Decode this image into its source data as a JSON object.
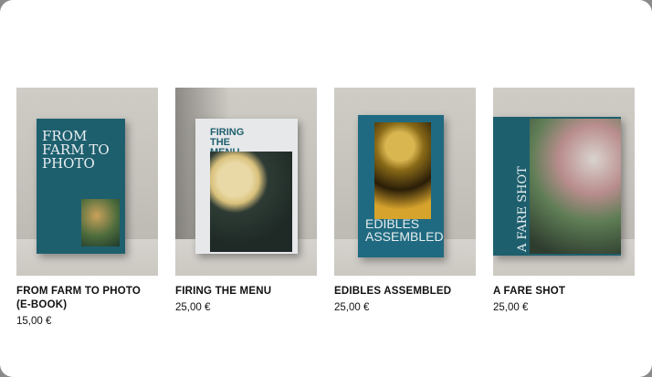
{
  "products": [
    {
      "title": "FROM FARM TO PHOTO (E-BOOK)",
      "price": "15,00 €",
      "cover_text": "FROM FARM TO PHOTO",
      "cover_color": "#1e5f6e"
    },
    {
      "title": "FIRING THE MENU",
      "price": "25,00 €",
      "cover_text": "FIRING THE MENU",
      "cover_color": "#e6e8ea"
    },
    {
      "title": "EDIBLES ASSEMBLED",
      "price": "25,00 €",
      "cover_text": "EDIBLES ASSEMBLED",
      "cover_color": "#1f6a80"
    },
    {
      "title": "A FARE SHOT",
      "price": "25,00 €",
      "cover_text": "A FARE SHOT",
      "cover_color": "#1e5f6e"
    }
  ]
}
